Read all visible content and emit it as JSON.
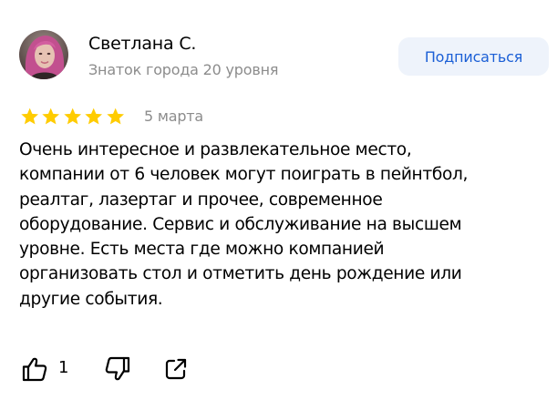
{
  "author": {
    "name": "Светлана С.",
    "rank": "Знаток города 20 уровня",
    "avatar_icon": "user-avatar-photo"
  },
  "subscribe": {
    "label": "Подписаться"
  },
  "rating": {
    "stars": 5,
    "max": 5,
    "color": "#ffcc00"
  },
  "date": "5 марта",
  "text_lines": [
    "Очень интересное и развлекательное место,",
    "компании от 6 человек могут поиграть в пейнтбол,",
    "реалтаг, лазертаг и прочее, современное",
    "оборудование. Сервис и обслуживание на высшем",
    "уровне. Есть места где можно компанией",
    "организовать стол и отметить день рождение или",
    "другие события."
  ],
  "actions": {
    "like_icon": "thumbs-up-icon",
    "like_count": "1",
    "dislike_icon": "thumbs-down-icon",
    "share_icon": "share-icon"
  },
  "colors": {
    "accent": "#1b5fd6",
    "button_bg": "#eef3fb",
    "muted_text": "#8c8c8c"
  }
}
